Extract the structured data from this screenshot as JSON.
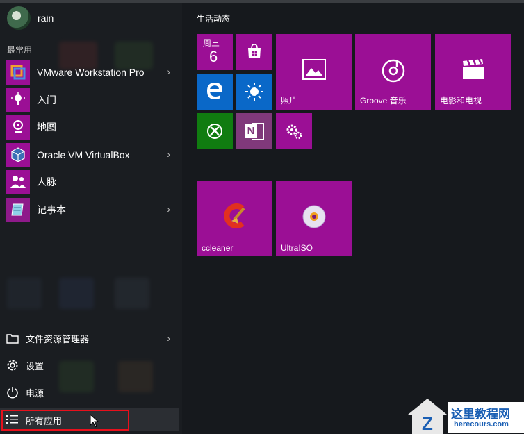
{
  "user": {
    "name": "rain"
  },
  "left": {
    "section_label": "最常用",
    "apps": [
      {
        "label": "VMware Workstation Pro",
        "icon": "vmware-icon",
        "has_submenu": true
      },
      {
        "label": "入门",
        "icon": "lightbulb-icon",
        "has_submenu": false
      },
      {
        "label": "地图",
        "icon": "map-icon",
        "has_submenu": false
      },
      {
        "label": "Oracle VM VirtualBox",
        "icon": "virtualbox-icon",
        "has_submenu": true
      },
      {
        "label": "人脉",
        "icon": "people-icon",
        "has_submenu": false
      },
      {
        "label": "记事本",
        "icon": "notepad-icon",
        "has_submenu": true
      }
    ],
    "bottom": {
      "file_explorer": "文件资源管理器",
      "settings": "设置",
      "power": "电源",
      "all_apps": "所有应用"
    },
    "chevron": "›"
  },
  "tiles": {
    "group_title": "生活动态",
    "calendar": {
      "weekday": "周三",
      "day": "6"
    },
    "photos": "照片",
    "groove": "Groove 音乐",
    "movies": "电影和电视",
    "ccleaner": "ccleaner",
    "ultraiso": "UltraISO",
    "onenote_letter": "N"
  },
  "watermark": {
    "title": "这里教程网",
    "url": "herecours.com"
  },
  "colors": {
    "tile_purple": "#9b0f95",
    "edge_blue": "#0a68c8",
    "xbox_green": "#107c10",
    "onenote_purple": "#80397b",
    "highlight_red": "#e8101c"
  }
}
